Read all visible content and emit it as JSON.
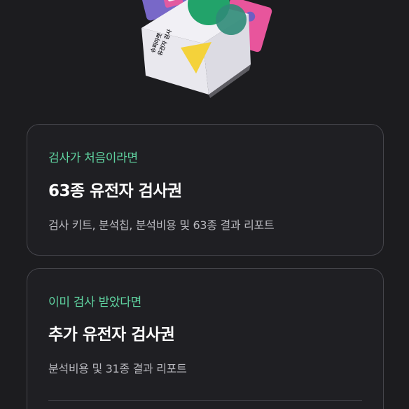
{
  "hero": {
    "box_label_line1": "슈퍼마켓",
    "box_label_line2": "유전자 검사"
  },
  "cards": [
    {
      "eyebrow": "검사가 처음이라면",
      "title": "63종 유전자 검사권",
      "description": "검사 키트, 분석칩, 분석비용 및 63종 결과 리포트"
    },
    {
      "eyebrow": "이미 검사 받았다면",
      "title": "추가 유전자 검사권",
      "description": "분석비용 및 31종 결과 리포트"
    }
  ],
  "colors": {
    "background": "#1c1c1f",
    "accent": "#5fd3a0",
    "card_border": "#45454b"
  }
}
